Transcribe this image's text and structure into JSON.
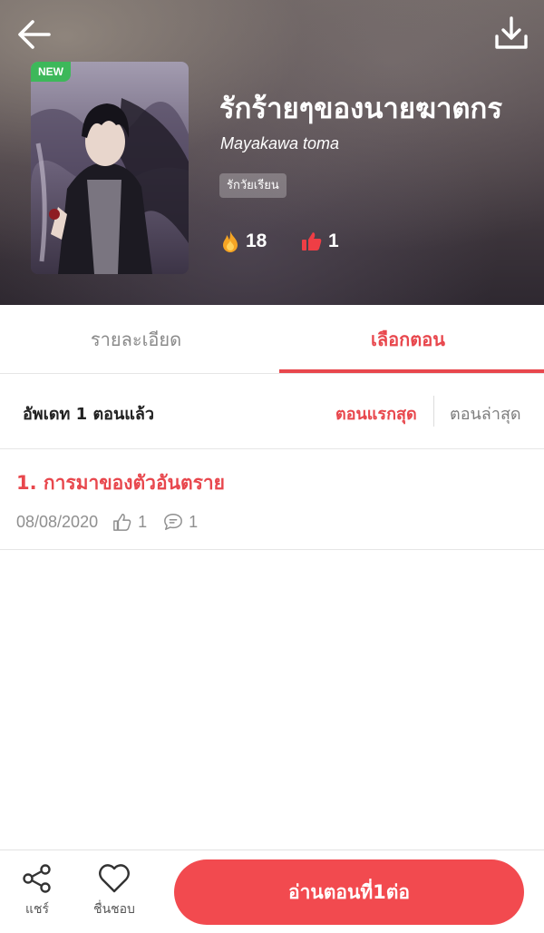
{
  "header": {
    "back_icon": "arrow-left-icon",
    "download_icon": "download-icon",
    "new_badge": "NEW",
    "title": "รักร้ายๆของนายฆาตกร",
    "author": "Mayakawa toma",
    "genre": "รักวัยเรียน",
    "views": "18",
    "likes": "1",
    "colors": {
      "views_icon": "#f5a524",
      "likes_icon": "#ef3e45"
    }
  },
  "tabs": [
    {
      "label": "รายละเอียด",
      "active": false
    },
    {
      "label": "เลือกตอน",
      "active": true
    }
  ],
  "sort": {
    "update_text": "อัพเดท 1 ตอนแล้ว",
    "first_label": "ตอนแรกสุด",
    "latest_label": "ตอนล่าสุด"
  },
  "episodes": [
    {
      "title": "1. การมาของตัวอันตราย",
      "date": "08/08/2020",
      "likes": "1",
      "comments": "1"
    }
  ],
  "bottom_bar": {
    "share_label": "แชร์",
    "favorite_label": "ชื่นชอบ",
    "read_label": "อ่านตอนที่1ต่อ"
  },
  "accent_color": "#e8474d"
}
